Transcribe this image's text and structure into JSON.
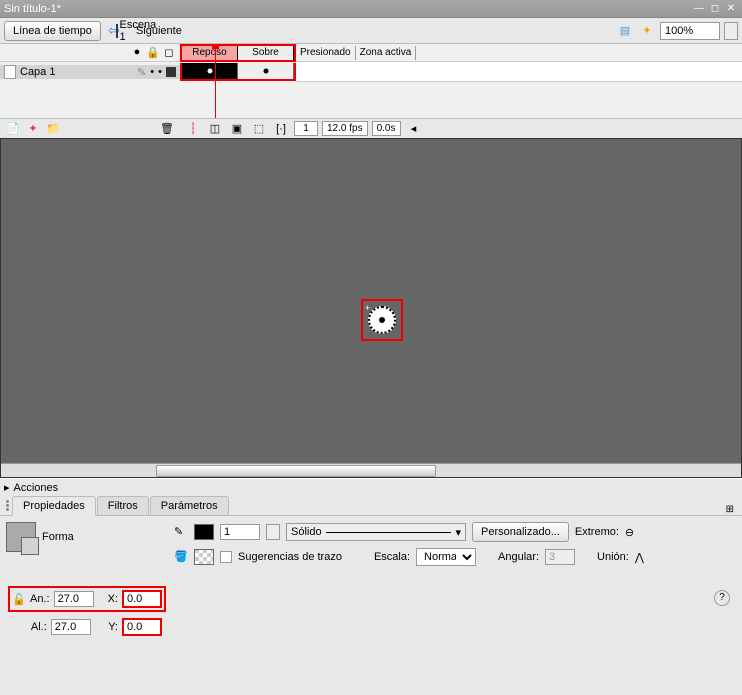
{
  "title": "Sin título-1*",
  "toolbar": {
    "timeline_btn": "Línea de tiempo",
    "scene": "Escena 1",
    "next": "Siguiente",
    "zoom": "100%"
  },
  "timeline": {
    "layer_name": "Capa 1",
    "tabs": {
      "reposo": "Reposo",
      "sobre": "Sobre",
      "presionado": "Presionado",
      "zona_activa": "Zona activa"
    },
    "current_frame": "1",
    "fps": "12.0 fps",
    "time": "0.0s"
  },
  "acciones": {
    "label": "Acciones"
  },
  "props": {
    "tabs": {
      "propiedades": "Propiedades",
      "filtros": "Filtros",
      "parametros": "Parámetros"
    },
    "shape_label": "Forma",
    "an_label": "An.:",
    "al_label": "Al.:",
    "x_label": "X:",
    "y_label": "Y:",
    "an": "27.0",
    "al": "27.0",
    "x": "0.0",
    "y": "0.0",
    "stroke_width": "1",
    "solido": "Sólido",
    "personalizado": "Personalizado...",
    "extremo": "Extremo:",
    "sugerencias": "Sugerencias de trazo",
    "escala": "Escala:",
    "escala_val": "Normal",
    "angular": "Angular:",
    "angular_val": "3",
    "union": "Unión:"
  }
}
